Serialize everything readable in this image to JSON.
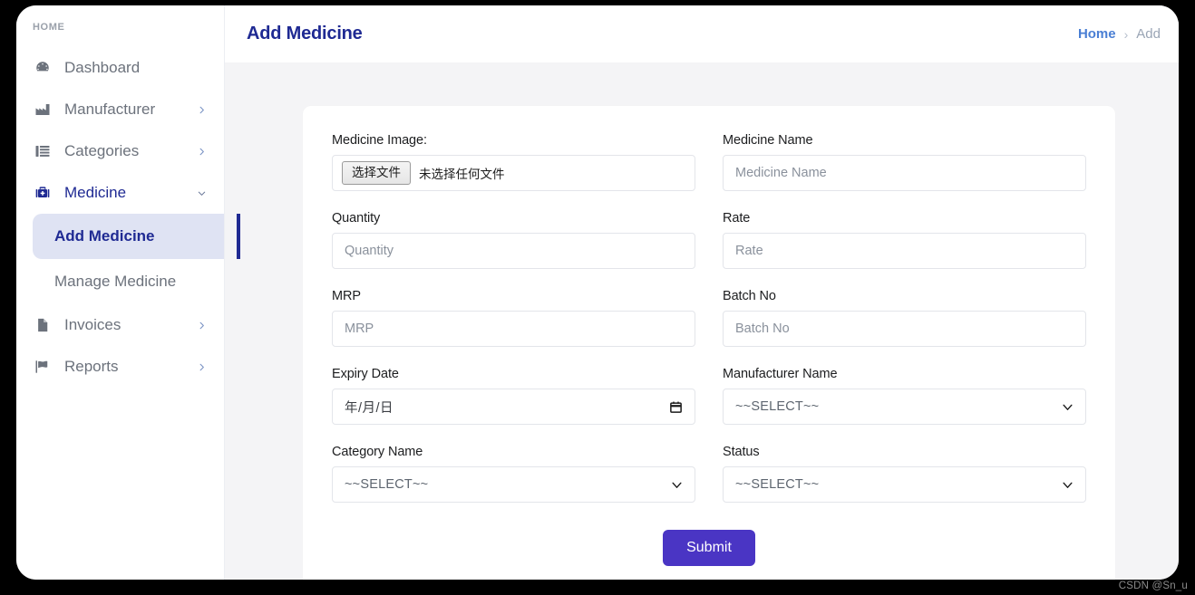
{
  "window": {
    "watermark": "CSDN @Sn_u"
  },
  "sidebar": {
    "heading": "HOME",
    "items": [
      {
        "label": "Dashboard",
        "icon": "dashboard-icon",
        "caret": ""
      },
      {
        "label": "Manufacturer",
        "icon": "factory-icon",
        "caret": "›"
      },
      {
        "label": "Categories",
        "icon": "list-icon",
        "caret": "›"
      },
      {
        "label": "Medicine",
        "icon": "medical-kit-icon",
        "caret": "∨"
      },
      {
        "label": "Invoices",
        "icon": "document-icon",
        "caret": "›"
      },
      {
        "label": "Reports",
        "icon": "flag-icon",
        "caret": "›"
      }
    ],
    "sub_items": [
      {
        "label": "Add Medicine"
      },
      {
        "label": "Manage Medicine"
      }
    ]
  },
  "header": {
    "title": "Add Medicine",
    "breadcrumb": {
      "home": "Home",
      "separator": "›",
      "current": "Add"
    }
  },
  "form": {
    "fields": [
      {
        "label": "Medicine Image:",
        "type": "file",
        "button_label": "选择文件",
        "status_text": "未选择任何文件"
      },
      {
        "label": "Medicine Name",
        "type": "text",
        "placeholder": "Medicine Name",
        "value": ""
      },
      {
        "label": "Quantity",
        "type": "text",
        "placeholder": "Quantity",
        "value": ""
      },
      {
        "label": "Rate",
        "type": "text",
        "placeholder": "Rate",
        "value": ""
      },
      {
        "label": "MRP",
        "type": "text",
        "placeholder": "MRP",
        "value": ""
      },
      {
        "label": "Batch No",
        "type": "text",
        "placeholder": "Batch No",
        "value": ""
      },
      {
        "label": "Expiry Date",
        "type": "date",
        "placeholder": "年/月/日",
        "value": ""
      },
      {
        "label": "Manufacturer Name",
        "type": "select",
        "selected": "~~SELECT~~",
        "options": [
          "~~SELECT~~"
        ]
      },
      {
        "label": "Category Name",
        "type": "select",
        "selected": "~~SELECT~~",
        "options": [
          "~~SELECT~~"
        ]
      },
      {
        "label": "Status",
        "type": "select",
        "selected": "~~SELECT~~",
        "options": [
          "~~SELECT~~"
        ]
      }
    ],
    "submit_label": "Submit"
  },
  "colors": {
    "brand_navy": "#1f2a93",
    "submit_purple": "#4a35c4",
    "active_bg": "#dfe3f3",
    "content_bg": "#f4f4f6",
    "crumb_link": "#4a7fd4"
  }
}
